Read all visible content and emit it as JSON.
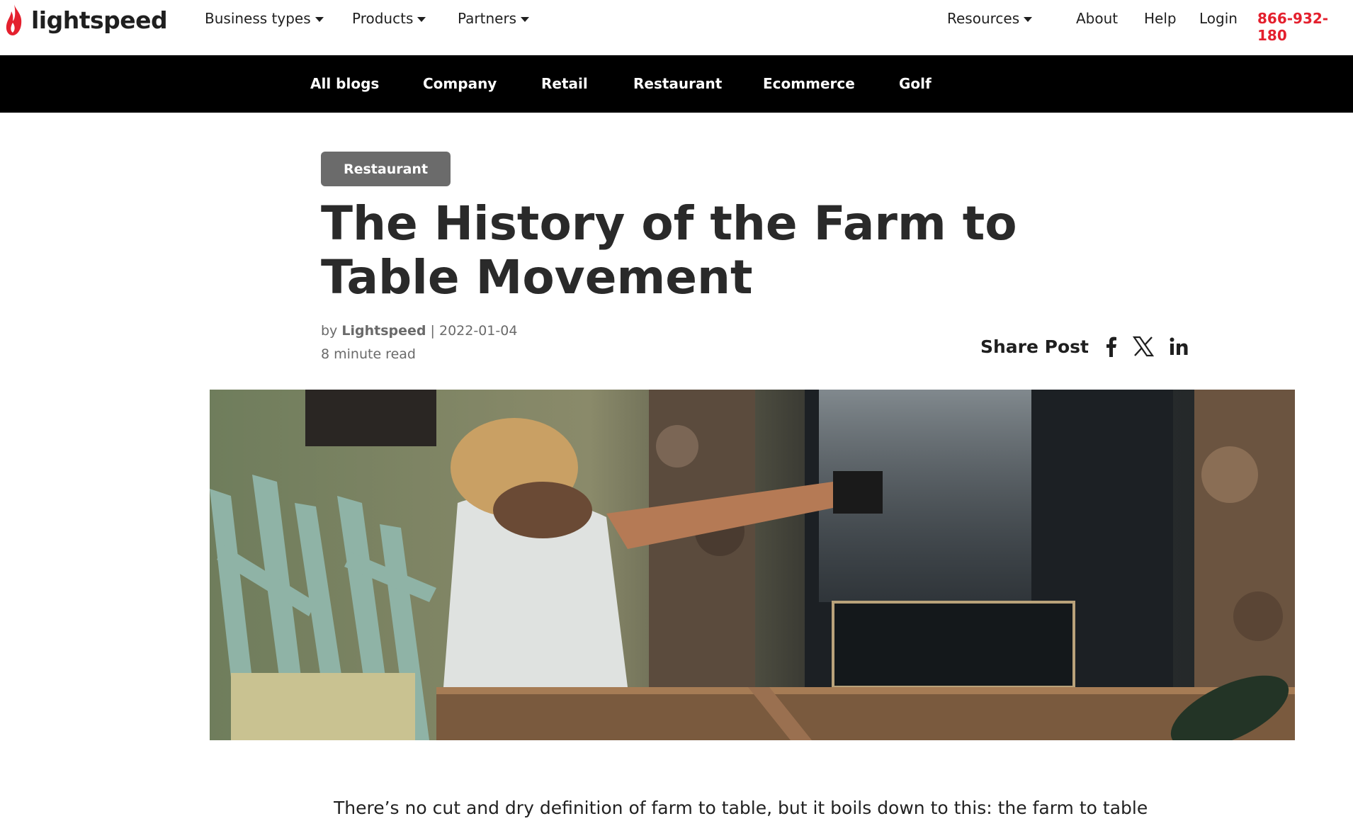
{
  "brand": {
    "name": "lightspeed",
    "accent": "#e4202e"
  },
  "topnav": {
    "business_types": "Business types",
    "products": "Products",
    "partners": "Partners",
    "resources": "Resources",
    "about": "About",
    "help": "Help",
    "login": "Login",
    "phone": "866-932-180"
  },
  "blognav": {
    "items": [
      "All blogs",
      "Company",
      "Retail",
      "Restaurant",
      "Ecommerce",
      "Golf"
    ]
  },
  "article": {
    "category": "Restaurant",
    "title": "The History of the Farm to Table Movement",
    "by": "by",
    "author": "Lightspeed",
    "separator": "|",
    "date": "2022-01-04",
    "read_time": "8 minute read",
    "share_label": "Share Post",
    "share_icons": [
      "facebook-icon",
      "x-icon",
      "linkedin-icon"
    ],
    "hero_image": "chef in straw hat grilling over wood fire beside fresh leeks",
    "intro": "There’s no cut and dry definition of farm to table, but it boils down to this: the farm to table"
  }
}
